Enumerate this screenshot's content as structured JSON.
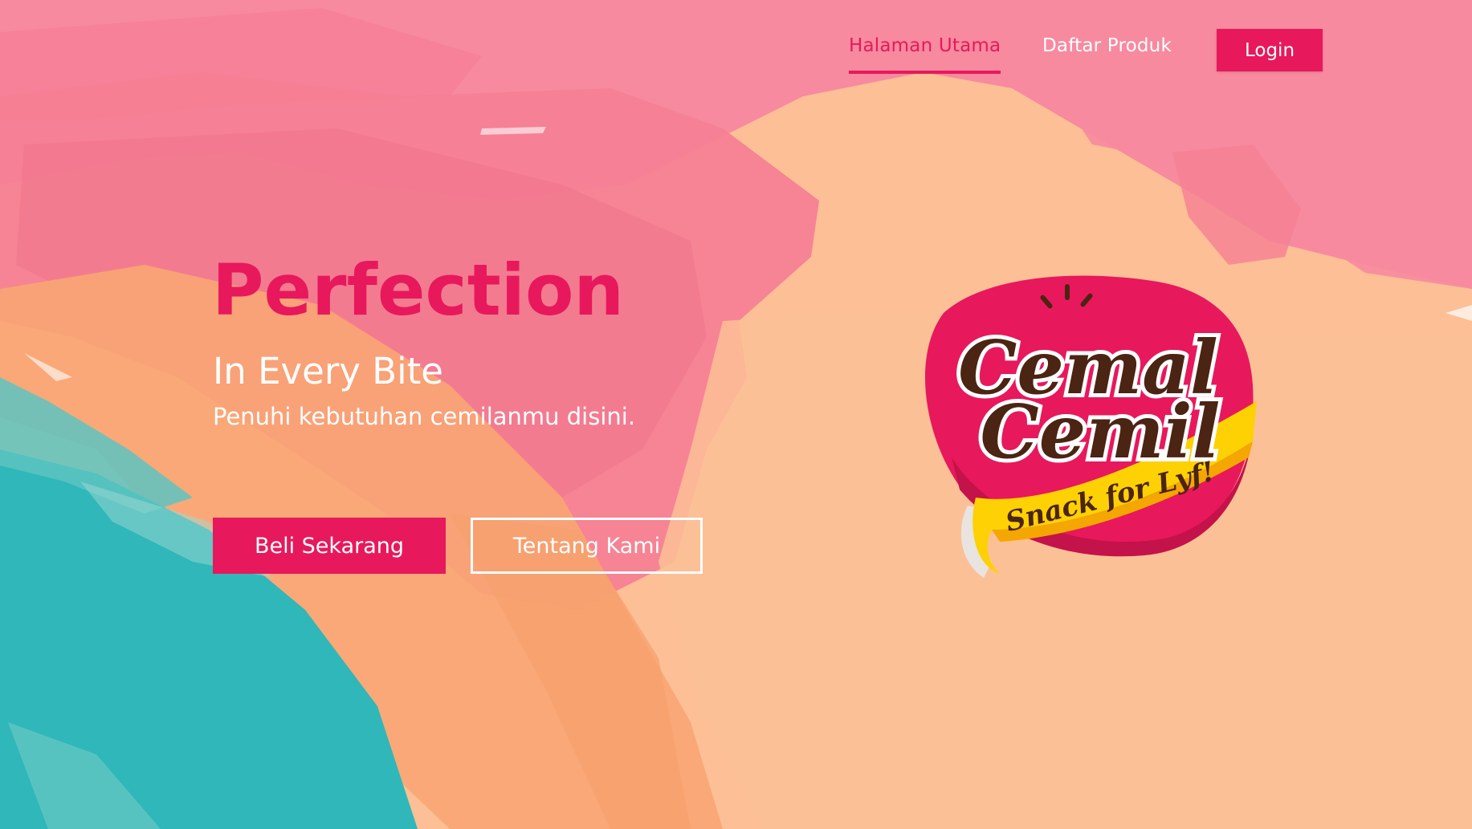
{
  "nav": {
    "items": [
      {
        "label": "Halaman Utama",
        "active": true
      },
      {
        "label": "Daftar Produk",
        "active": false
      }
    ],
    "login_label": "Login"
  },
  "hero": {
    "title": "Perfection",
    "subtitle": "In Every Bite",
    "description": "Penuhi kebutuhan cemilanmu disini.",
    "primary_button": "Beli Sekarang",
    "secondary_button": "Tentang Kami"
  },
  "logo": {
    "line1": "Cemal",
    "line2": "Cemil",
    "tagline": "Snack for Lyf!"
  },
  "colors": {
    "accent": "#e8185c",
    "pink_brush": "#f7869c",
    "peach": "#fcbf96",
    "orange": "#f9a574",
    "teal": "#2fb7b9",
    "logo_brown": "#4b2413",
    "ribbon_yellow": "#fdd103"
  }
}
